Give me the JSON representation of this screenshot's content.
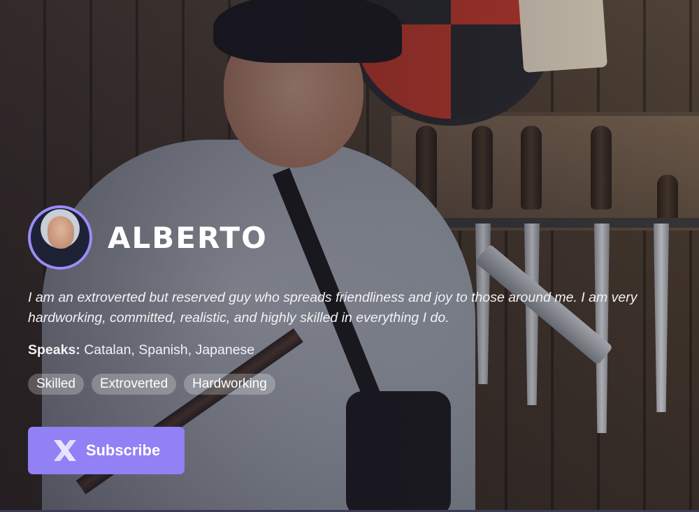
{
  "profile": {
    "name": "ALBERTO",
    "bio": "I am an extroverted but reserved guy who spreads friendliness and joy to those around me. I am very hardworking, committed, realistic, and highly skilled in everything I do.",
    "speaks_label": "Speaks:",
    "speaks_value": "Catalan, Spanish, Japanese",
    "tags": [
      "Skilled",
      "Extroverted",
      "Hardworking"
    ]
  },
  "action": {
    "subscribe_label": "Subscribe",
    "subscribe_icon": "x-icon"
  },
  "colors": {
    "accent": "#9280f5",
    "avatar_ring": "#9b8cf7",
    "tag_bg": "rgba(255,255,255,0.25)"
  }
}
